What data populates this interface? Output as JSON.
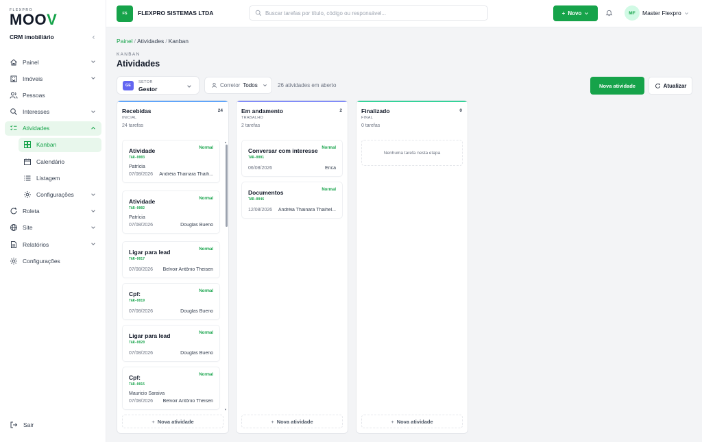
{
  "brand": {
    "eyebrow": "FLEXPRO",
    "logo": "MOOV",
    "org": "CRM imobiliário",
    "accent": "#16a34a"
  },
  "sidebar": {
    "items": [
      {
        "label": "Painel",
        "icon": "home-icon"
      },
      {
        "label": "Imóveis",
        "icon": "building-icon"
      },
      {
        "label": "Pessoas",
        "icon": "users-icon"
      },
      {
        "label": "Interesses",
        "icon": "search-icon"
      },
      {
        "label": "Atividades",
        "icon": "list-check-icon"
      },
      {
        "label": "Kanban",
        "icon": "kanban-icon"
      },
      {
        "label": "Calendário",
        "icon": "calendar-icon"
      },
      {
        "label": "Listagem",
        "icon": "list-icon"
      },
      {
        "label": "Configurações",
        "icon": "gear-icon"
      },
      {
        "label": "Roleta",
        "icon": "refresh-icon"
      },
      {
        "label": "Site",
        "icon": "globe-icon"
      },
      {
        "label": "Relatórios",
        "icon": "report-icon"
      },
      {
        "label": "Configurações",
        "icon": "gear-icon"
      }
    ],
    "logout": "Sair"
  },
  "topbar": {
    "company_initials": "FS",
    "company_name": "FLEXPRO SISTEMAS LTDA",
    "search_placeholder": "Buscar tarefas por título, código ou responsável...",
    "new_label": "Novo",
    "user_initials": "MF",
    "user_name": "Master Flexpro"
  },
  "header": {
    "breadcrumb": [
      "Painel",
      "Atividades",
      "Kanban"
    ],
    "eyebrow": "KANBAN",
    "title": "Atividades"
  },
  "filters": {
    "setor_badge": "GE",
    "setor_label": "SETOR",
    "setor_value": "Gestor",
    "corretor_label": "Corretor",
    "corretor_value": "Todos",
    "open_count": "26 atividades em aberto",
    "new_activity": "Nova atividade",
    "refresh": "Atualizar"
  },
  "columns": [
    {
      "title": "Recebidas",
      "count": "24",
      "stage": "INICIAL",
      "tasks": "24 tarefas",
      "color": "#60a5fa",
      "footer": "Nova atividade",
      "cards": [
        {
          "title": "Atividade",
          "priority": "Normal",
          "code": "TAR-0003",
          "subtitle": "Patrícia",
          "date": "07/08/2026",
          "assignee": "Andréia Thainara Thaih..."
        },
        {
          "title": "Atividade",
          "priority": "Normal",
          "code": "TAR-0002",
          "subtitle": "Patrícia",
          "date": "07/08/2026",
          "assignee": "Douglas Bueno"
        },
        {
          "title": "Ligar para lead",
          "priority": "Normal",
          "code": "TAR-0017",
          "subtitle": "",
          "date": "07/08/2026",
          "assignee": "Belvoir Antônio Theisen"
        },
        {
          "title": "Cpf:",
          "priority": "Normal",
          "code": "TAR-0019",
          "subtitle": "",
          "date": "07/08/2026",
          "assignee": "Douglas Bueno"
        },
        {
          "title": "Ligar para lead",
          "priority": "Normal",
          "code": "TAR-0020",
          "subtitle": "",
          "date": "07/08/2026",
          "assignee": "Douglas Bueno"
        },
        {
          "title": "Cpf:",
          "priority": "Normal",
          "code": "TAR-0015",
          "subtitle": "Mauricio Saraiva",
          "date": "07/08/2026",
          "assignee": "Belvoir Antônio Theisen"
        }
      ]
    },
    {
      "title": "Em andamento",
      "count": "2",
      "stage": "TRABALHO",
      "tasks": "2 tarefas",
      "color": "#818cf8",
      "footer": "Nova atividade",
      "cards": [
        {
          "title": "Conversar com interesse",
          "priority": "Normal",
          "code": "TAR-0001",
          "subtitle": "",
          "date": "06/08/2026",
          "assignee": "Érica"
        },
        {
          "title": "Documentos",
          "priority": "Normal",
          "code": "TAR-0046",
          "subtitle": "",
          "date": "12/08/2026",
          "assignee": "Andréia Thainara Thaihel..."
        }
      ]
    },
    {
      "title": "Finalizado",
      "count": "0",
      "stage": "FINAL",
      "tasks": "0 tarefas",
      "color": "#34d399",
      "footer": "Nova atividade",
      "empty": "Nenhuma tarefa nesta etapa",
      "cards": []
    }
  ]
}
